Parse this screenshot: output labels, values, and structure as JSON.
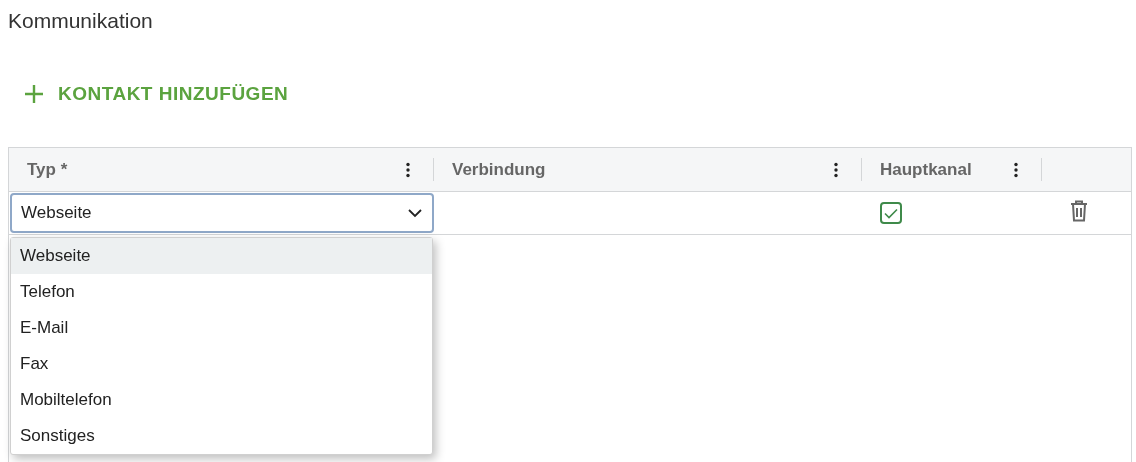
{
  "section_title": "Kommunikation",
  "add_button": {
    "label": "KONTAKT HINZUFÜGEN"
  },
  "table": {
    "columns": [
      {
        "label": "Typ *"
      },
      {
        "label": "Verbindung"
      },
      {
        "label": "Hauptkanal"
      }
    ],
    "rows": [
      {
        "typ": "Webseite",
        "main_channel": true
      }
    ]
  },
  "dropdown": {
    "options": [
      {
        "label": "Webseite",
        "selected": true
      },
      {
        "label": "Telefon",
        "selected": false
      },
      {
        "label": "E-Mail",
        "selected": false
      },
      {
        "label": "Fax",
        "selected": false
      },
      {
        "label": "Mobiltelefon",
        "selected": false
      },
      {
        "label": "Sonstiges",
        "selected": false
      }
    ]
  }
}
